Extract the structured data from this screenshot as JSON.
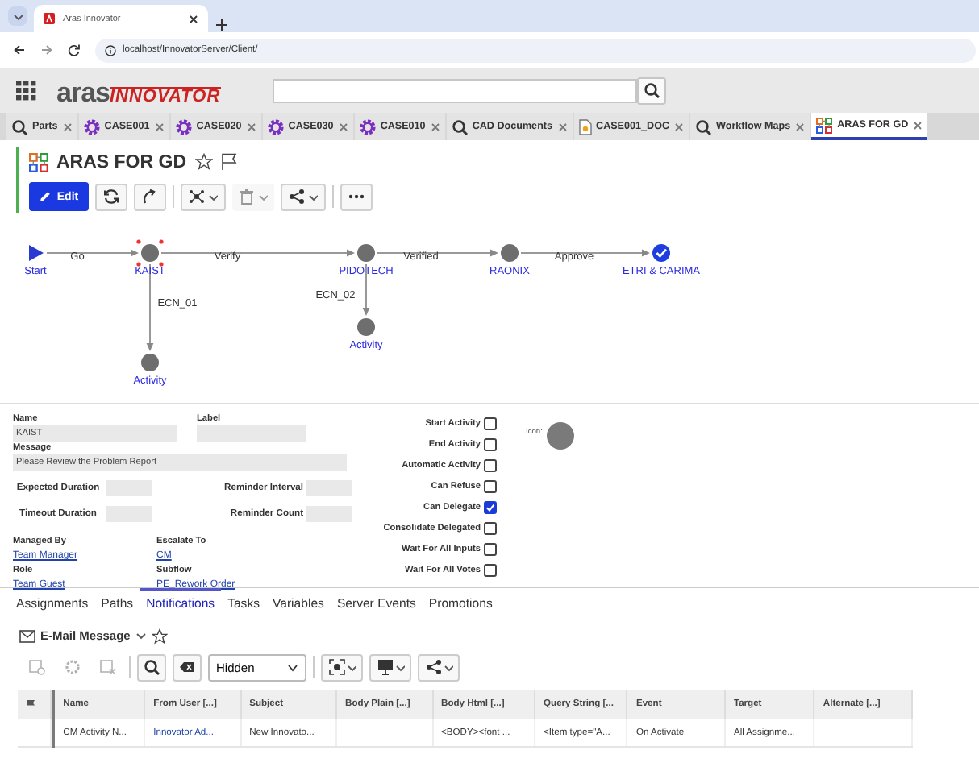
{
  "browser": {
    "tab_title": "Aras Innovator",
    "address": "localhost/InnovatorServer/Client/"
  },
  "app": {
    "logo_main": "aras",
    "logo_sub": "INNOVATOR"
  },
  "tabs": [
    {
      "label": "Parts",
      "kind": "search",
      "selected": false
    },
    {
      "label": "CASE001",
      "kind": "gear",
      "selected": false
    },
    {
      "label": "CASE020",
      "kind": "gear",
      "selected": false
    },
    {
      "label": "CASE030",
      "kind": "gear",
      "selected": false
    },
    {
      "label": "CASE010",
      "kind": "gear",
      "selected": false
    },
    {
      "label": "CAD Documents",
      "kind": "search",
      "selected": false
    },
    {
      "label": "CASE001_DOC",
      "kind": "document",
      "selected": false
    },
    {
      "label": "Workflow Maps",
      "kind": "search",
      "selected": false
    },
    {
      "label": "ARAS FOR GD",
      "kind": "workflow",
      "selected": true
    }
  ],
  "item": {
    "title": "ARAS FOR GD",
    "edit": "Edit"
  },
  "workflow": {
    "nodes": [
      {
        "label": "Start",
        "kind": "start",
        "selected": false
      },
      {
        "label": "KAIST",
        "kind": "activity",
        "selected": true
      },
      {
        "label": "PIDOTECH",
        "kind": "activity",
        "selected": false
      },
      {
        "label": "RAONIX",
        "kind": "activity",
        "selected": false
      },
      {
        "label": "ETRI & CARIMA",
        "kind": "end",
        "selected": false
      },
      {
        "label": "Activity",
        "kind": "activity",
        "selected": false
      },
      {
        "label": "Activity",
        "kind": "activity",
        "selected": false
      }
    ],
    "paths": [
      {
        "label": "Go"
      },
      {
        "label": "Verify"
      },
      {
        "label": "Verified"
      },
      {
        "label": "Approve"
      },
      {
        "label": "ECN_01"
      },
      {
        "label": "ECN_02"
      }
    ]
  },
  "form": {
    "fields": [
      {
        "label": "Name",
        "value": "KAIST"
      },
      {
        "label": "Label"
      },
      {
        "label": "Message",
        "value": "Please Review the Problem Report"
      }
    ],
    "durations": [
      {
        "label": "Expected Duration"
      },
      {
        "label": "Reminder Interval"
      },
      {
        "label": "Timeout Duration"
      },
      {
        "label": "Reminder Count"
      }
    ],
    "links": [
      {
        "label": "Managed By",
        "value": "Team Manager"
      },
      {
        "label": "Escalate To",
        "value": "CM"
      },
      {
        "label": "Role",
        "value": "Team Guest"
      },
      {
        "label": "Subflow",
        "value": "PE_Rework Order"
      }
    ],
    "options": [
      {
        "label": "Start Activity",
        "checked": false
      },
      {
        "label": "End Activity",
        "checked": false
      },
      {
        "label": "Automatic Activity",
        "checked": false
      },
      {
        "label": "Can Refuse",
        "checked": false
      },
      {
        "label": "Can Delegate",
        "checked": true
      },
      {
        "label": "Consolidate Delegated",
        "checked": false
      },
      {
        "label": "Wait For All Inputs",
        "checked": false
      },
      {
        "label": "Wait For All Votes",
        "checked": false
      }
    ],
    "icon_label": "Icon:"
  },
  "relationship_tabs": [
    {
      "label": "Assignments",
      "selected": false
    },
    {
      "label": "Paths",
      "selected": false
    },
    {
      "label": "Notifications",
      "selected": true
    },
    {
      "label": "Tasks",
      "selected": false
    },
    {
      "label": "Variables",
      "selected": false
    },
    {
      "label": "Server Events",
      "selected": false
    },
    {
      "label": "Promotions",
      "selected": false
    }
  ],
  "relationship": {
    "title": "E-Mail Message",
    "filter": "Hidden",
    "columns": [
      "Name",
      "From User [...]",
      "Subject",
      "Body Plain [...]",
      "Body Html [...]",
      "Query String [...",
      "Event",
      "Target",
      "Alternate [...]"
    ],
    "rows": [
      {
        "cells": [
          {
            "text": "CM Activity N...",
            "kind": "text"
          },
          {
            "text": "Innovator Ad...",
            "kind": "link"
          },
          {
            "text": "New Innovato...",
            "kind": "text"
          },
          null,
          {
            "text": "<BODY><font ...",
            "kind": "text"
          },
          {
            "text": "<Item type=\"A...",
            "kind": "text"
          },
          {
            "text": "On Activate",
            "kind": "text"
          },
          {
            "text": "All Assignme...",
            "kind": "text"
          },
          null
        ]
      }
    ]
  }
}
